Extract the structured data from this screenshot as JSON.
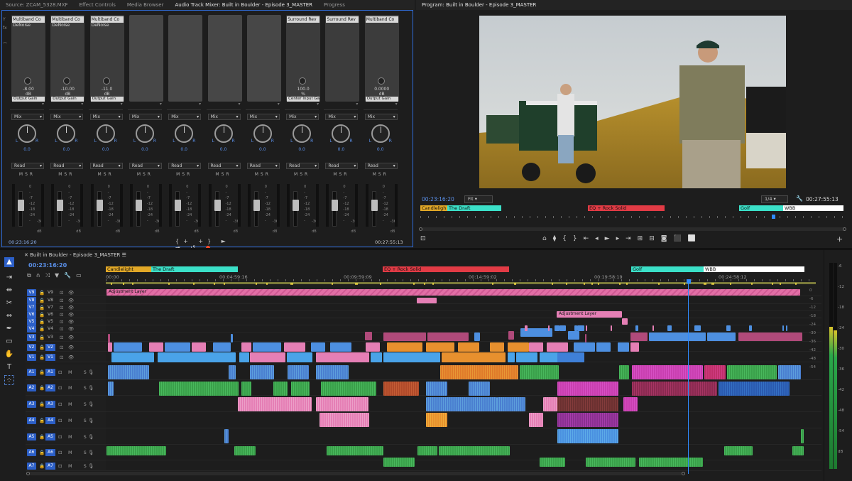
{
  "top_tabs": {
    "source": "Source: ZCAM_5328.MXF",
    "effect": "Effect Controls",
    "media": "Media Browser",
    "mixer": "Audio Track Mixer: Built in Boulder - Episode 3_MASTER",
    "progress": "Progress"
  },
  "mixer": {
    "channels": [
      {
        "fx": "Multiband Co",
        "sub": "DeNoise",
        "val": "-8.00",
        "unit": "dB",
        "param": "Output Gain"
      },
      {
        "fx": "Multiband Co",
        "sub": "DeNoise",
        "val": "-10.00",
        "unit": "dB",
        "param": "Output Gain"
      },
      {
        "fx": "Multiband Co",
        "sub": "DeNoise",
        "val": "-11.0",
        "unit": "dB",
        "param": "Output Gain"
      },
      {
        "fx": "",
        "sub": "",
        "val": "",
        "unit": "",
        "param": ""
      },
      {
        "fx": "",
        "sub": "",
        "val": "",
        "unit": "",
        "param": ""
      },
      {
        "fx": "",
        "sub": "",
        "val": "",
        "unit": "",
        "param": ""
      },
      {
        "fx": "",
        "sub": "",
        "val": "",
        "unit": "",
        "param": ""
      },
      {
        "fx": "Surround Rev",
        "sub": "",
        "val": "100.0",
        "unit": "%",
        "param": "Center Input Gai"
      },
      {
        "fx": "Surround Rev",
        "sub": "",
        "val": "",
        "unit": "",
        "param": ""
      },
      {
        "fx": "Multiband Co",
        "sub": "",
        "val": "0.0000",
        "unit": "dB",
        "param": "Output Gain"
      }
    ],
    "mix_label": "Mix",
    "read_label": "Read",
    "pan_value": "0.0",
    "msr": "MSR",
    "scale": [
      "0",
      "-",
      "-7",
      "-12",
      "-18",
      "-24",
      "-"
    ],
    "scale_right": "-36",
    "db": "dB",
    "timecode_left": "00:23:16:20",
    "timecode_right": "00:27:55:13"
  },
  "program": {
    "title": "Program: Built in Boulder - Episode 3_MASTER",
    "timecode": "00:23:16:20",
    "fit": "Fit",
    "res": "1/4",
    "duration": "00:27:55:13",
    "markers": [
      {
        "label": "Candleligh",
        "color": "#e2a827"
      },
      {
        "label": "The Draft",
        "color": "#3be0c8"
      },
      {
        "label": "EQ + Rock Solid",
        "color": "#e23b45"
      },
      {
        "label": "Golf",
        "color": "#3be0c8"
      },
      {
        "label": "WBB",
        "color": "#ffffff"
      }
    ]
  },
  "timeline": {
    "tab": "Built in Boulder - Episode 3_MASTER",
    "timecode": "00:23:16:20",
    "ruler": [
      "00:00",
      "00:04:59:16",
      "00:09:59:09",
      "00:14:59:02",
      "00:19:58:19",
      "00:24:58:12"
    ],
    "markers": [
      {
        "label": "Candlelight",
        "color": "#e2a827"
      },
      {
        "label": "The Draft",
        "color": "#3be0c8"
      },
      {
        "label": "EQ + Rock Solid",
        "color": "#e23b45"
      },
      {
        "label": "Golf",
        "color": "#3be0c8"
      },
      {
        "label": "WBB",
        "color": "#ffffff"
      }
    ],
    "adj1": "Adjustment Layer",
    "adj2": "Adjustment Layer",
    "video_tracks": [
      "V9",
      "V8",
      "V7",
      "V6",
      "V5",
      "V4",
      "V3",
      "V2",
      "V1"
    ],
    "audio_tracks": [
      "A1",
      "A2",
      "A3",
      "A4",
      "A5",
      "A6",
      "A7"
    ],
    "ms": "M S",
    "meter_scale": [
      "-6",
      "-12",
      "-18",
      "-24",
      "-30",
      "-36",
      "-42",
      "-48",
      "-54",
      "dB"
    ],
    "right_scale": [
      "0",
      "-6",
      "-12",
      "-18",
      "-24",
      "-30",
      "-36",
      "-42",
      "-48",
      "-54"
    ]
  }
}
